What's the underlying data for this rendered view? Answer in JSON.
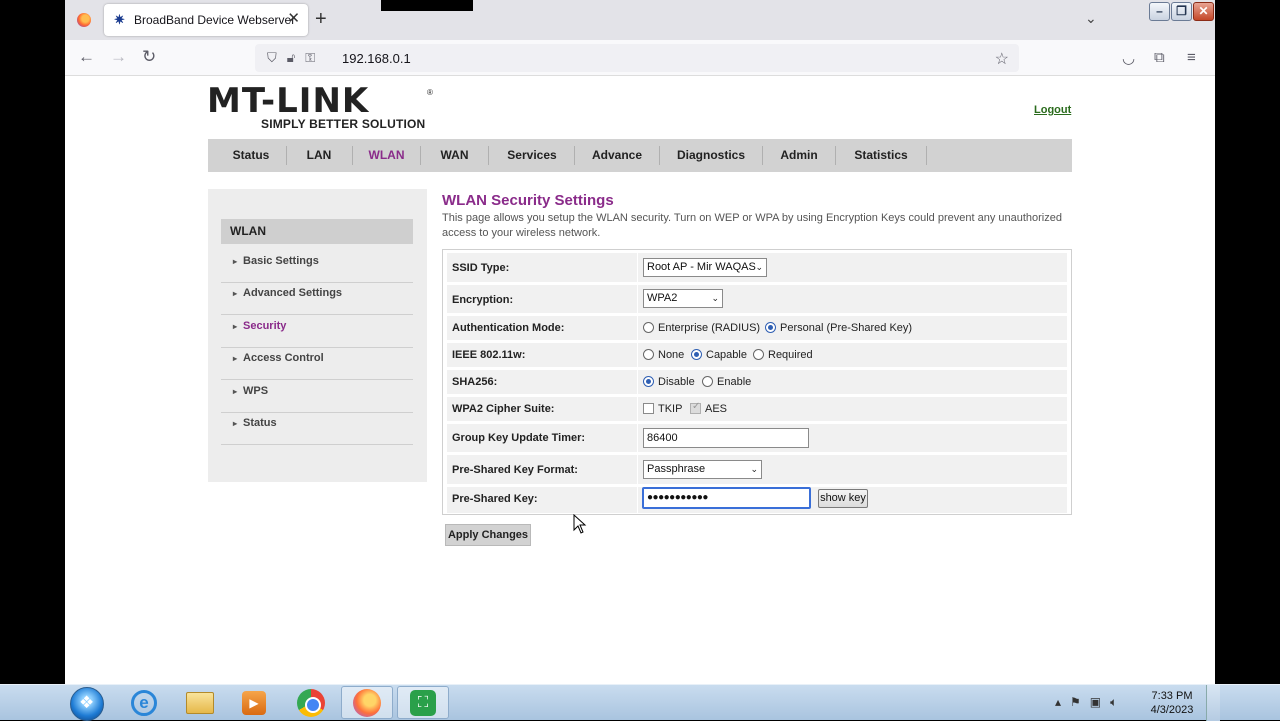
{
  "browser": {
    "tab_title": "BroadBand Device Webserver",
    "tab_close": "✕",
    "new_tab": "+",
    "url": "192.168.0.1"
  },
  "header": {
    "logo_main": "MT-LINK",
    "logo_sub": "SIMPLY BETTER SOLUTION",
    "logout": "Logout"
  },
  "menu": [
    {
      "label": "Status"
    },
    {
      "label": "LAN"
    },
    {
      "label": "WLAN"
    },
    {
      "label": "WAN"
    },
    {
      "label": "Services"
    },
    {
      "label": "Advance"
    },
    {
      "label": "Diagnostics"
    },
    {
      "label": "Admin"
    },
    {
      "label": "Statistics"
    }
  ],
  "sidebar": {
    "heading": "WLAN",
    "items": [
      {
        "label": "Basic Settings"
      },
      {
        "label": "Advanced Settings"
      },
      {
        "label": "Security"
      },
      {
        "label": "Access Control"
      },
      {
        "label": "WPS"
      },
      {
        "label": "Status"
      }
    ]
  },
  "content": {
    "title": "WLAN Security Settings",
    "description": "This page allows you setup the WLAN security. Turn on WEP or WPA by using Encryption Keys could prevent any unauthorized access to your wireless network.",
    "fields": {
      "ssid_type": {
        "label": "SSID Type:",
        "value": "Root AP - Mir WAQAS"
      },
      "encryption": {
        "label": "Encryption:",
        "value": "WPA2"
      },
      "auth_mode": {
        "label": "Authentication Mode:",
        "opt1": "Enterprise (RADIUS)",
        "opt2": "Personal (Pre-Shared Key)"
      },
      "ieee": {
        "label": "IEEE 802.11w:",
        "opt1": "None",
        "opt2": "Capable",
        "opt3": "Required"
      },
      "sha256": {
        "label": "SHA256:",
        "opt1": "Disable",
        "opt2": "Enable"
      },
      "cipher": {
        "label": "WPA2 Cipher Suite:",
        "opt1": "TKIP",
        "opt2": "AES"
      },
      "group_key": {
        "label": "Group Key Update Timer:",
        "value": "86400"
      },
      "psk_format": {
        "label": "Pre-Shared Key Format:",
        "value": "Passphrase"
      },
      "psk": {
        "label": "Pre-Shared Key:",
        "value": "●●●●●●●●●●●",
        "show_key": "show key"
      }
    },
    "apply": "Apply Changes"
  },
  "taskbar": {
    "time": "7:33 PM",
    "date": "4/3/2023"
  }
}
